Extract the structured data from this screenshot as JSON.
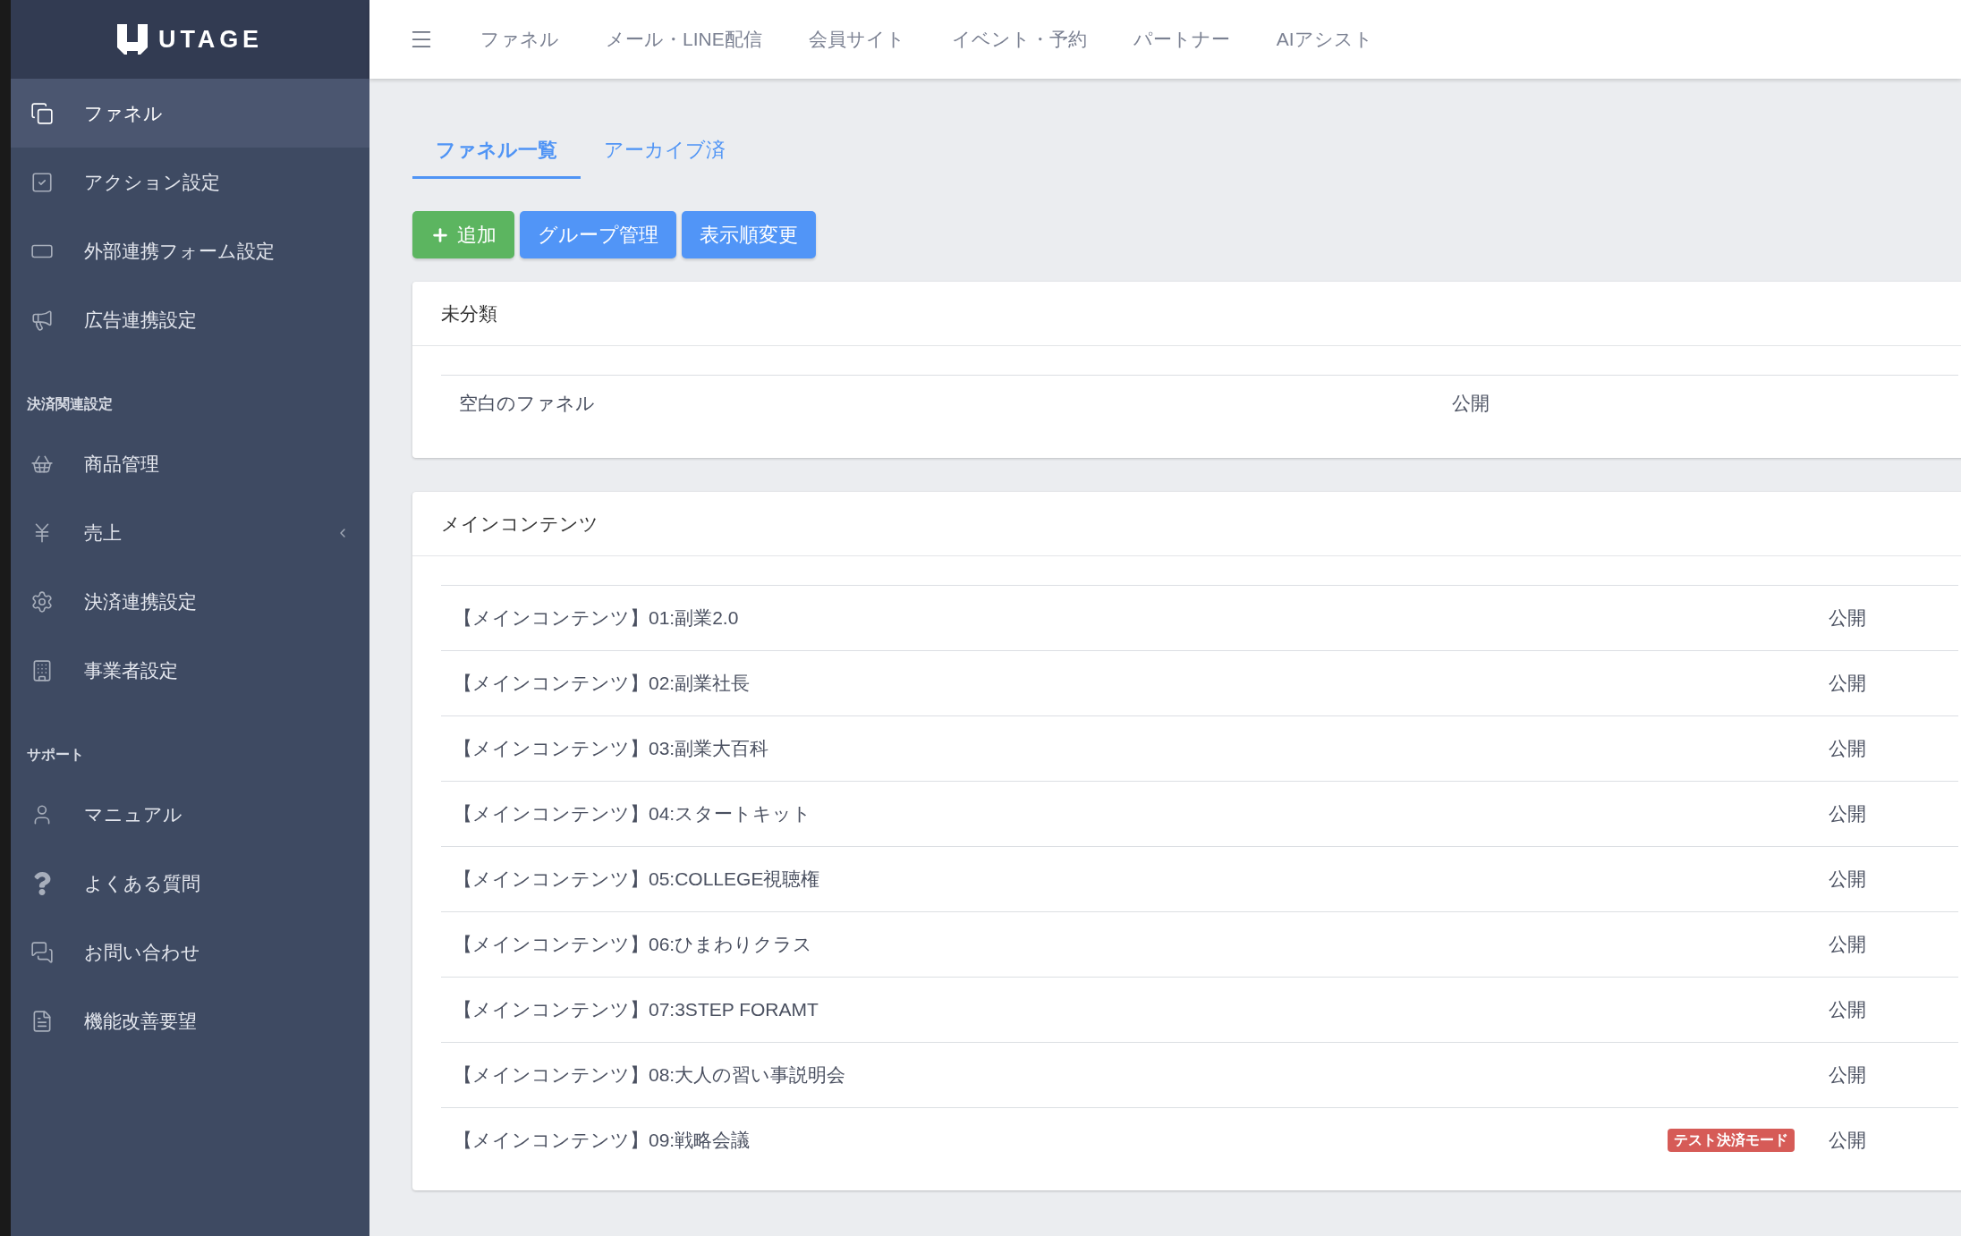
{
  "sidebar": {
    "logo": "UTAGE",
    "sections": [
      {
        "items": [
          {
            "label": "ファネル",
            "selected": true
          },
          {
            "label": "アクション設定",
            "selected": false
          },
          {
            "label": "外部連携フォーム設定",
            "selected": false
          },
          {
            "label": "広告連携設定",
            "selected": false
          }
        ]
      },
      {
        "heading": "決済関連設定",
        "items": [
          {
            "label": "商品管理",
            "selected": false
          },
          {
            "label": "売上",
            "selected": false,
            "expanded": false
          },
          {
            "label": "決済連携設定",
            "selected": false
          },
          {
            "label": "事業者設定",
            "selected": false
          }
        ]
      },
      {
        "heading": "サポート",
        "items": [
          {
            "label": "マニュアル",
            "selected": false
          },
          {
            "label": "よくある質問",
            "selected": false
          },
          {
            "label": "お問い合わせ",
            "selected": false
          },
          {
            "label": "機能改善要望",
            "selected": false
          }
        ]
      }
    ]
  },
  "top_nav": [
    "ファネル",
    "メール・LINE配信",
    "会員サイト",
    "イベント・予約",
    "パートナー",
    "AIアシスト"
  ],
  "tabs": [
    {
      "label": "ファネル一覧",
      "selected": true
    },
    {
      "label": "アーカイブ済",
      "selected": false
    }
  ],
  "buttons": [
    {
      "label": "追加",
      "kind": "add"
    },
    {
      "label": "グループ管理",
      "kind": "primary"
    },
    {
      "label": "表示順変更",
      "kind": "primary"
    }
  ],
  "groups": [
    {
      "title": "未分類",
      "rows": [
        {
          "name": "空白のファネル",
          "status": "公開"
        }
      ]
    },
    {
      "title": "メインコンテンツ",
      "rows": [
        {
          "name": "【メインコンテンツ】01:副業2.0",
          "status": "公開"
        },
        {
          "name": "【メインコンテンツ】02:副業社長",
          "status": "公開"
        },
        {
          "name": "【メインコンテンツ】03:副業大百科",
          "status": "公開"
        },
        {
          "name": "【メインコンテンツ】04:スタートキット",
          "status": "公開"
        },
        {
          "name": "【メインコンテンツ】05:COLLEGE視聴権",
          "status": "公開"
        },
        {
          "name": "【メインコンテンツ】06:ひまわりクラス",
          "status": "公開"
        },
        {
          "name": "【メインコンテンツ】07:3STEP FORAMT",
          "status": "公開"
        },
        {
          "name": "【メインコンテンツ】08:大人の習い事説明会",
          "status": "公開"
        },
        {
          "name": "【メインコンテンツ】09:戦略会議",
          "status": "公開",
          "badge": "テスト決済モード"
        }
      ]
    }
  ]
}
